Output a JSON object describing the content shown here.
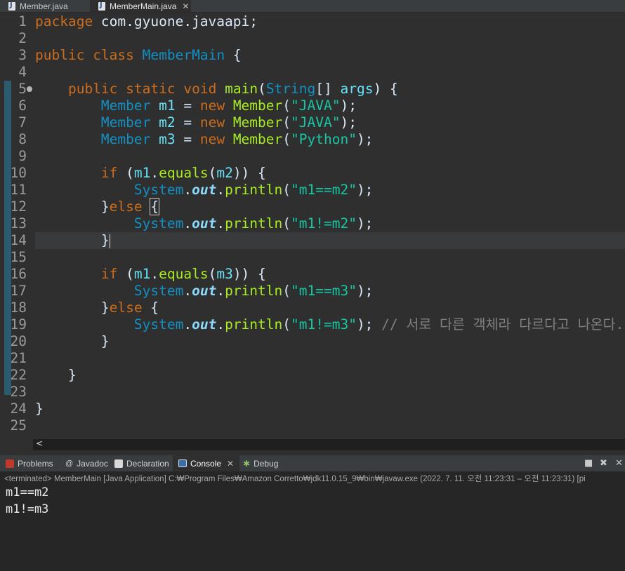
{
  "editor_tabs": [
    {
      "label": "Member.java",
      "active": false
    },
    {
      "label": "MemberMain.java",
      "active": true
    }
  ],
  "code_lines": [
    {
      "num": "1"
    },
    {
      "num": "2"
    },
    {
      "num": "3"
    },
    {
      "num": "4"
    },
    {
      "num": "5"
    },
    {
      "num": "6"
    },
    {
      "num": "7"
    },
    {
      "num": "8"
    },
    {
      "num": "9"
    },
    {
      "num": "10"
    },
    {
      "num": "11"
    },
    {
      "num": "12"
    },
    {
      "num": "13"
    },
    {
      "num": "14"
    },
    {
      "num": "15"
    },
    {
      "num": "16"
    },
    {
      "num": "17"
    },
    {
      "num": "18"
    },
    {
      "num": "19"
    },
    {
      "num": "20"
    },
    {
      "num": "21"
    },
    {
      "num": "22"
    },
    {
      "num": "23"
    },
    {
      "num": "24"
    },
    {
      "num": "25"
    }
  ],
  "code": {
    "l1": {
      "kw": "package",
      "rest": " com.gyuone.javaapi;"
    },
    "l3": {
      "kw1": "public",
      "kw2": "class",
      "name": "MemberMain",
      "rest": " {"
    },
    "l5": {
      "kw1": "public",
      "kw2": "static",
      "kw3": "void",
      "fn": "main",
      "p1": "(",
      "ty": "String",
      "p2": "[] ",
      "arg": "args",
      "p3": ") {"
    },
    "l6": {
      "ty": "Member",
      "var": "m1",
      "eq": " = ",
      "kw": "new",
      "cls": " Member",
      "p1": "(",
      "str": "\"JAVA\"",
      "p2": ");"
    },
    "l7": {
      "ty": "Member",
      "var": "m2",
      "eq": " = ",
      "kw": "new",
      "cls": " Member",
      "p1": "(",
      "str": "\"JAVA\"",
      "p2": ");"
    },
    "l8": {
      "ty": "Member",
      "var": "m3",
      "eq": " = ",
      "kw": "new",
      "cls": " Member",
      "p1": "(",
      "str": "\"Python\"",
      "p2": ");"
    },
    "l10": {
      "kw": "if",
      "p1": " (",
      "v1": "m1",
      "dot": ".",
      "fn": "equals",
      "p2": "(",
      "v2": "m2",
      "p3": ")) {"
    },
    "l11": {
      "sys": "System",
      "dot": ".",
      "out": "out",
      "dot2": ".",
      "fn": "println",
      "p1": "(",
      "str": "\"m1==m2\"",
      "p2": ");"
    },
    "l12": {
      "p1": "}",
      "kw": "else",
      "p2": " ",
      "brace": "{"
    },
    "l13": {
      "sys": "System",
      "dot": ".",
      "out": "out",
      "dot2": ".",
      "fn": "println",
      "p1": "(",
      "str": "\"m1!=m2\"",
      "p2": ");"
    },
    "l14": {
      "p1": "}"
    },
    "l16": {
      "kw": "if",
      "p1": " (",
      "v1": "m1",
      "dot": ".",
      "fn": "equals",
      "p2": "(",
      "v2": "m3",
      "p3": ")) {"
    },
    "l17": {
      "sys": "System",
      "dot": ".",
      "out": "out",
      "dot2": ".",
      "fn": "println",
      "p1": "(",
      "str": "\"m1==m3\"",
      "p2": ");"
    },
    "l18": {
      "p1": "}",
      "kw": "else",
      "p2": " {"
    },
    "l19": {
      "sys": "System",
      "dot": ".",
      "out": "out",
      "dot2": ".",
      "fn": "println",
      "p1": "(",
      "str": "\"m1!=m3\"",
      "p2": "); ",
      "cm": "// 서로 다른 객체라 다르다고 나온다."
    },
    "l20": {
      "p1": "}"
    },
    "l22": {
      "p1": "}"
    },
    "l24": {
      "p1": "}"
    }
  },
  "hscroll_arrow": "<",
  "panel_tabs": [
    {
      "label": "Problems",
      "active": false
    },
    {
      "label": "Javadoc",
      "active": false
    },
    {
      "label": "Declaration",
      "active": false
    },
    {
      "label": "Console",
      "active": true
    },
    {
      "label": "Debug",
      "active": false
    }
  ],
  "console": {
    "header": "<terminated> MemberMain [Java Application] C:₩Program Files₩Amazon Corretto₩jdk11.0.15_9₩bin₩javaw.exe  (2022. 7. 11. 오전 11:23:31 – 오전 11:23:31) [pi",
    "output": [
      "m1==m2",
      "m1!=m3"
    ]
  },
  "colors": {
    "keyword": "#cc6c1d",
    "type": "#1290c3",
    "method": "#a7ec21",
    "string": "#17c6a3",
    "comment": "#808080",
    "background": "#2f2f2f"
  }
}
